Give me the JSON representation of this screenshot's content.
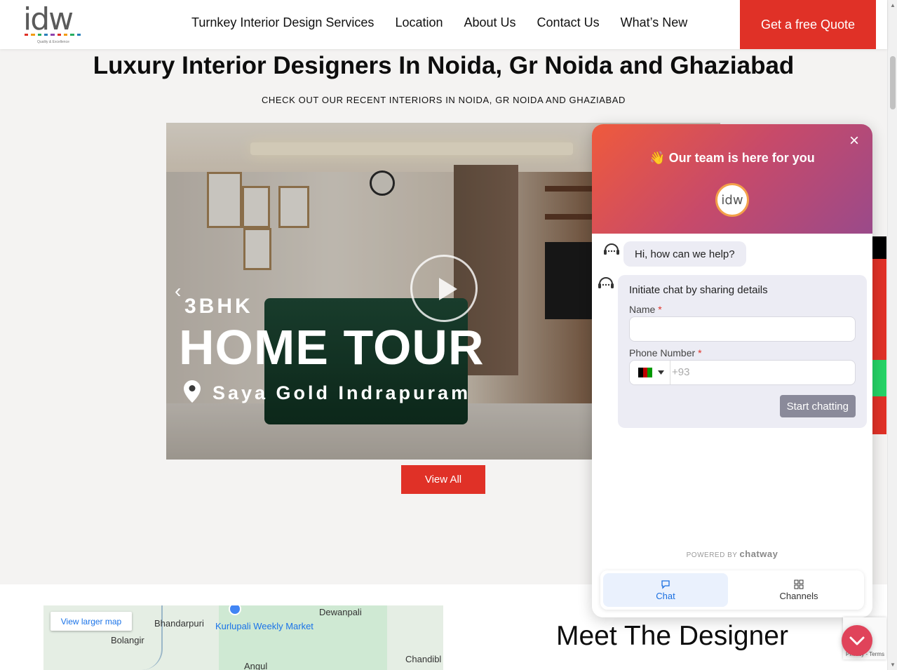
{
  "header": {
    "logo_text": "idw",
    "logo_tagline": "Quality & Excellence",
    "nav": [
      "Turnkey Interior Design Services",
      "Location",
      "About Us",
      "Contact Us",
      "What’s New"
    ],
    "quote_button": "Get a free Quote"
  },
  "hero": {
    "title": "Luxury Interior Designers In Noida, Gr Noida and Ghaziabad",
    "subtitle": "CHECK OUT OUR RECENT INTERIORS IN NOIDA, GR NOIDA AND GHAZIABAD"
  },
  "video": {
    "line1": "3BHK",
    "line2": "HOME TOUR",
    "location": "Saya Gold Indrapuram",
    "prev_arrow": "‹"
  },
  "view_all": "View All",
  "map": {
    "larger_map": "View larger map",
    "labels": [
      "Dewanpali",
      "Bhandarpuri",
      "Kurlupali Weekly Market",
      "Bolangir",
      "Chandibl",
      "Angul"
    ]
  },
  "meet_designer": "Meet The Designer",
  "chat": {
    "title": "👋 Our team is here for you",
    "avatar_text": "idw",
    "close": "×",
    "greeting": "Hi, how can we help?",
    "form_title": "Initiate chat by sharing details",
    "name_label": "Name",
    "phone_label": "Phone Number",
    "required_mark": "*",
    "phone_placeholder": "+93",
    "start_button": "Start chatting",
    "powered_by": "POWERED BY",
    "brand": "chatway",
    "tabs": [
      "Chat",
      "Channels"
    ]
  },
  "recaptcha": {
    "text": "Privacy - Terms"
  },
  "colors": {
    "accent": "#e03127",
    "chat_gradient_start": "#ef5a3c",
    "chat_gradient_end": "#9a4a8a",
    "chat_tab_active": "#1a6fe0"
  }
}
